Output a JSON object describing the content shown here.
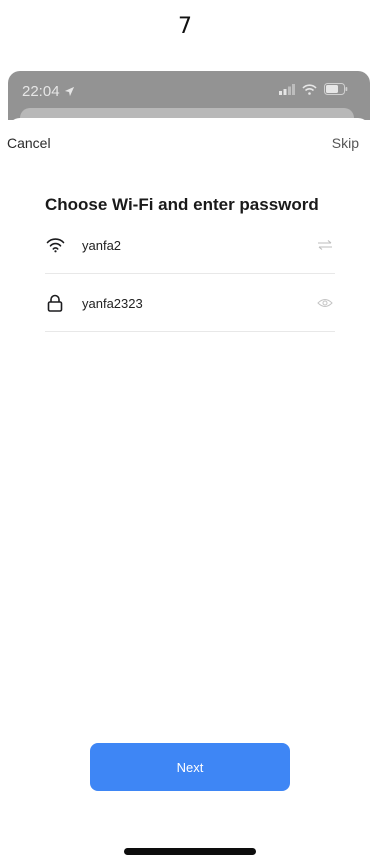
{
  "page_number": "7",
  "status_bar": {
    "time": "22:04",
    "icons": [
      "location-arrow-icon",
      "signal-bars-icon",
      "wifi-icon",
      "battery-icon"
    ]
  },
  "nav": {
    "cancel_label": "Cancel",
    "skip_label": "Skip"
  },
  "form": {
    "title": "Choose Wi-Fi and enter password",
    "ssid": {
      "value": "yanfa2",
      "icon": "wifi-icon",
      "action_icon": "switch-network-icon"
    },
    "password": {
      "value": "yanfa2323",
      "icon": "lock-icon",
      "action_icon": "eye-icon"
    }
  },
  "actions": {
    "next_label": "Next"
  },
  "colors": {
    "primary": "#3e86f5",
    "overlay": "#939393",
    "divider": "#e8e8e8"
  }
}
